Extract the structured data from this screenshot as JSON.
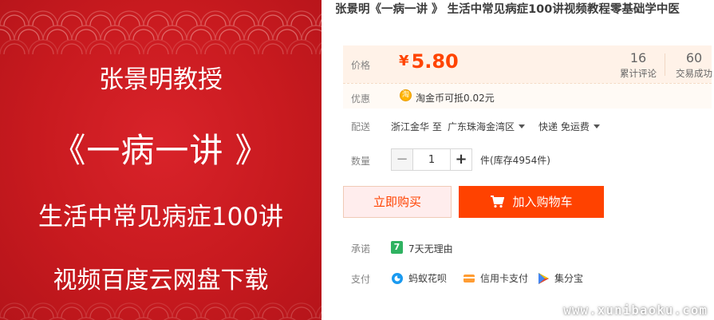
{
  "product_image": {
    "line1": "张景明教授",
    "line2": "《一病一讲 》",
    "line3": "生活中常见病症100讲",
    "line4": "视频百度云网盘下载"
  },
  "title": "张景明《一病一讲 》 生活中常见病症100讲视频教程零基础学中医",
  "price": {
    "label": "价格",
    "currency": "¥",
    "value": "5.80"
  },
  "stats": {
    "reviews_count": "16",
    "reviews_label": "累计评论",
    "deals_count": "60",
    "deals_label": "交易成功"
  },
  "promotion": {
    "label": "优惠",
    "coin_icon_text": "淘",
    "text": "淘金币可抵0.02元"
  },
  "shipping": {
    "label": "配送",
    "from": "浙江金华 至",
    "to": "广东珠海金湾区",
    "method": "快递 免运费"
  },
  "quantity": {
    "label": "数量",
    "minus": "−",
    "value": "1",
    "plus": "+",
    "stock": "件(库存4954件)"
  },
  "buttons": {
    "buy_now": "立即购买",
    "add_to_cart": "加入购物车"
  },
  "promise": {
    "label": "承诺",
    "badge": "7",
    "text": "7天无理由"
  },
  "payment": {
    "label": "支付",
    "methods": [
      {
        "name": "蚂蚁花呗",
        "icon": "huabei-icon"
      },
      {
        "name": "信用卡支付",
        "icon": "credit-card-icon"
      },
      {
        "name": "集分宝",
        "icon": "jifenbao-icon"
      }
    ]
  },
  "watermark": "www.xunibaoku.com",
  "colors": {
    "accent": "#ff4200",
    "image_red": "#c81a1f",
    "price_bg": "#fff2e8"
  }
}
